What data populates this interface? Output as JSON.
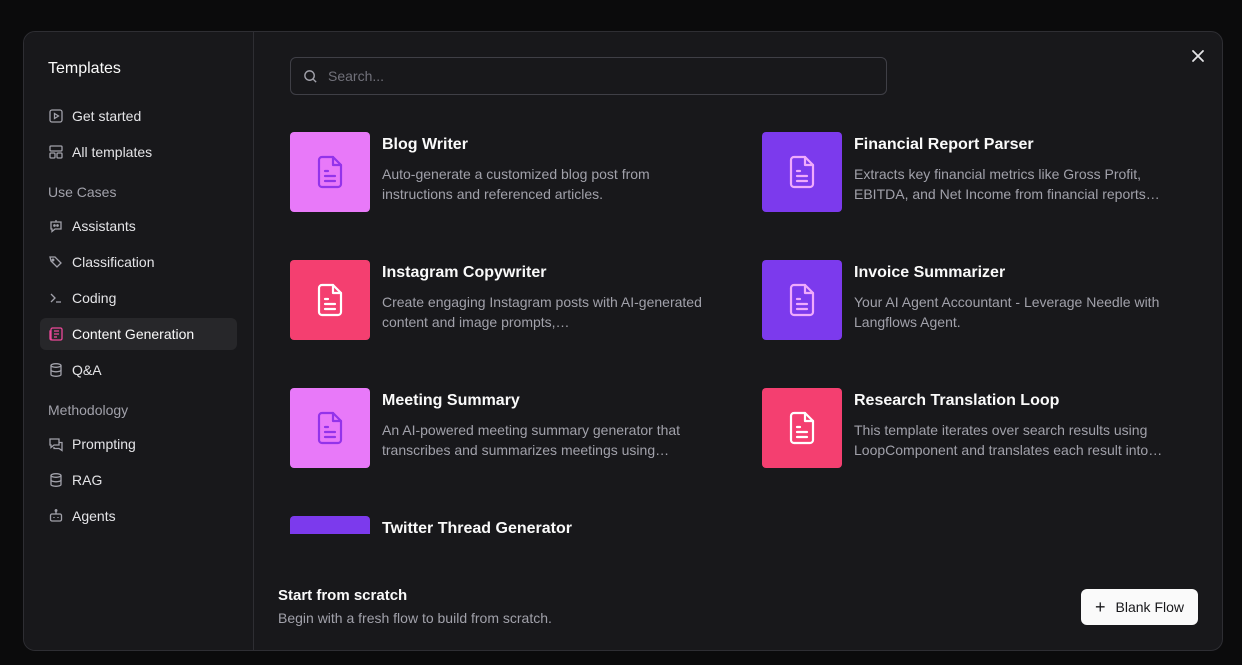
{
  "sidebar": {
    "title": "Templates",
    "top_items": [
      {
        "label": "Get started",
        "icon": "play-square-icon"
      },
      {
        "label": "All templates",
        "icon": "layout-grid-icon"
      }
    ],
    "use_cases_title": "Use Cases",
    "use_cases": [
      {
        "label": "Assistants",
        "icon": "bot-message-icon"
      },
      {
        "label": "Classification",
        "icon": "tags-icon"
      },
      {
        "label": "Coding",
        "icon": "terminal-icon"
      },
      {
        "label": "Content Generation",
        "icon": "newspaper-icon"
      },
      {
        "label": "Q&A",
        "icon": "database-icon"
      }
    ],
    "methodology_title": "Methodology",
    "methodology": [
      {
        "label": "Prompting",
        "icon": "message-square-text-icon"
      },
      {
        "label": "RAG",
        "icon": "database-icon"
      },
      {
        "label": "Agents",
        "icon": "bot-icon"
      }
    ]
  },
  "search": {
    "placeholder": "Search..."
  },
  "cards": [
    {
      "title": "Blog Writer",
      "desc": "Auto-generate a customized blog post from instructions and referenced articles.",
      "color": "#e879f9",
      "icon_color": "#9333ea"
    },
    {
      "title": "Financial Report Parser",
      "desc": "Extracts key financial metrics like Gross Profit, EBITDA, and Net Income from financial reports…",
      "color": "#7c3aed",
      "icon_color": "#f0abfc"
    },
    {
      "title": "Instagram Copywriter",
      "desc": "Create engaging Instagram posts with AI-generated content and image prompts,…",
      "color": "#f43f70",
      "icon_color": "#ffffff"
    },
    {
      "title": "Invoice Summarizer",
      "desc": "Your AI Agent Accountant - Leverage Needle with Langflows Agent.",
      "color": "#7c3aed",
      "icon_color": "#f0abfc"
    },
    {
      "title": "Meeting Summary",
      "desc": "An AI-powered meeting summary generator that transcribes and summarizes meetings using…",
      "color": "#e879f9",
      "icon_color": "#9333ea"
    },
    {
      "title": "Research Translation Loop",
      "desc": "This template iterates over search results using LoopComponent and translates each result into…",
      "color": "#f43f70",
      "icon_color": "#ffffff"
    },
    {
      "title": "Twitter Thread Generator",
      "desc": "",
      "color": "#7c3aed",
      "icon_color": "#f0abfc"
    }
  ],
  "footer": {
    "title": "Start from scratch",
    "subtitle": "Begin with a fresh flow to build from scratch.",
    "button_label": "Blank Flow"
  }
}
